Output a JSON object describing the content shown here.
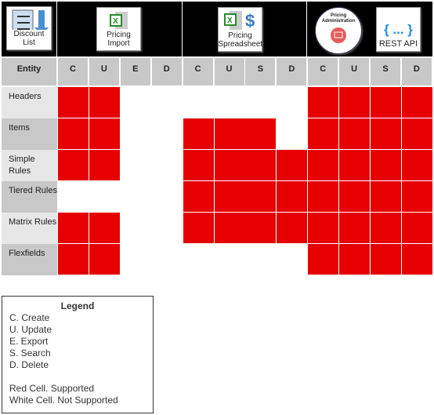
{
  "tools": [
    {
      "label": "Discount List",
      "icon": "checklist-download-icon"
    },
    {
      "label": "Pricing Import",
      "icon": "excel-icon"
    },
    {
      "label": "Pricing Spreadsheet",
      "icon": "excel-dollar-icon"
    },
    {
      "label": "Pricing Administration",
      "icon": "pricing-admin-icon"
    },
    {
      "label": "REST API",
      "icon": "braces-icon",
      "glyph": "{ ... }"
    }
  ],
  "columns": {
    "entity": "Entity",
    "ops": [
      "C",
      "U",
      "E",
      "D",
      "C",
      "U",
      "S",
      "D",
      "C",
      "U",
      "S",
      "D"
    ]
  },
  "rows": [
    {
      "entity": "Headers",
      "supported": [
        1,
        1,
        0,
        0,
        0,
        0,
        0,
        0,
        1,
        1,
        1,
        1
      ]
    },
    {
      "entity": "Items",
      "supported": [
        1,
        1,
        0,
        0,
        1,
        1,
        1,
        0,
        1,
        1,
        1,
        1
      ]
    },
    {
      "entity": "Simple Rules",
      "supported": [
        1,
        1,
        0,
        0,
        1,
        1,
        1,
        1,
        1,
        1,
        1,
        1
      ]
    },
    {
      "entity": "Tiered Rules",
      "supported": [
        0,
        0,
        0,
        0,
        1,
        1,
        1,
        1,
        1,
        1,
        1,
        1
      ]
    },
    {
      "entity": "Matrix Rules",
      "supported": [
        1,
        1,
        0,
        0,
        1,
        1,
        1,
        1,
        1,
        1,
        1,
        1
      ]
    },
    {
      "entity": "Flexfields",
      "supported": [
        1,
        1,
        0,
        0,
        0,
        0,
        0,
        0,
        1,
        1,
        1,
        1
      ]
    }
  ],
  "colors": {
    "supported": "#e60000",
    "not_supported": "#ffffff"
  },
  "legend": {
    "title": "Legend",
    "items": [
      "C. Create",
      "U. Update",
      "E. Export",
      "S. Search",
      "D. Delete"
    ],
    "notes": [
      "Red Cell. Supported",
      "White Cell. Not Supported"
    ]
  }
}
